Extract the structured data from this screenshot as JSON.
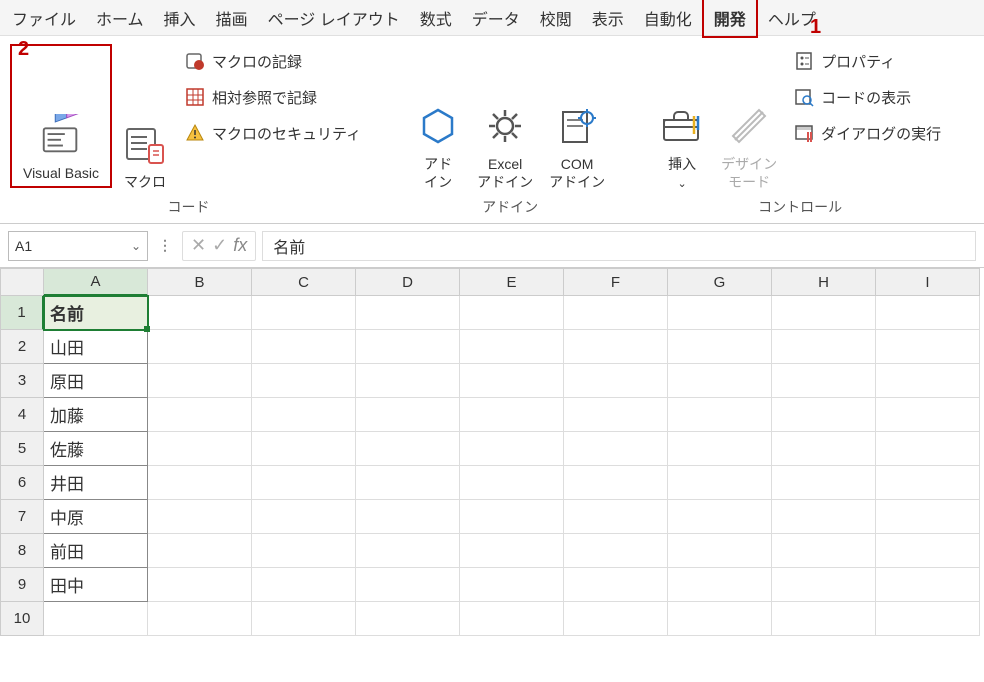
{
  "annotations": {
    "one": "1",
    "two": "2"
  },
  "menu": {
    "file": "ファイル",
    "home": "ホーム",
    "insert": "挿入",
    "draw": "描画",
    "page_layout": "ページ レイアウト",
    "formula": "数式",
    "data": "データ",
    "review": "校閲",
    "view": "表示",
    "automate": "自動化",
    "developer": "開発",
    "help": "ヘルプ"
  },
  "ribbon": {
    "code": {
      "visual_basic": "Visual Basic",
      "macros": "マクロ",
      "record_macro": "マクロの記録",
      "relative_ref": "相対参照で記録",
      "macro_security": "マクロのセキュリティ",
      "group_label": "コード"
    },
    "addins": {
      "addins": "アド\nイン",
      "excel_addins": "Excel\nアドイン",
      "com_addins": "COM\nアドイン",
      "group_label": "アドイン"
    },
    "controls": {
      "insert": "挿入",
      "design_mode": "デザイン\nモード",
      "properties": "プロパティ",
      "view_code": "コードの表示",
      "run_dialog": "ダイアログの実行",
      "group_label": "コントロール"
    }
  },
  "formula_bar": {
    "name_box": "A1",
    "fx": "fx",
    "value": "名前"
  },
  "sheet": {
    "cols": [
      "A",
      "B",
      "C",
      "D",
      "E",
      "F",
      "G",
      "H",
      "I"
    ],
    "rows": [
      "1",
      "2",
      "3",
      "4",
      "5",
      "6",
      "7",
      "8",
      "9",
      "10"
    ],
    "data": {
      "A1": "名前",
      "A2": "山田",
      "A3": "原田",
      "A4": "加藤",
      "A5": "佐藤",
      "A6": "井田",
      "A7": "中原",
      "A8": "前田",
      "A9": "田中"
    }
  }
}
